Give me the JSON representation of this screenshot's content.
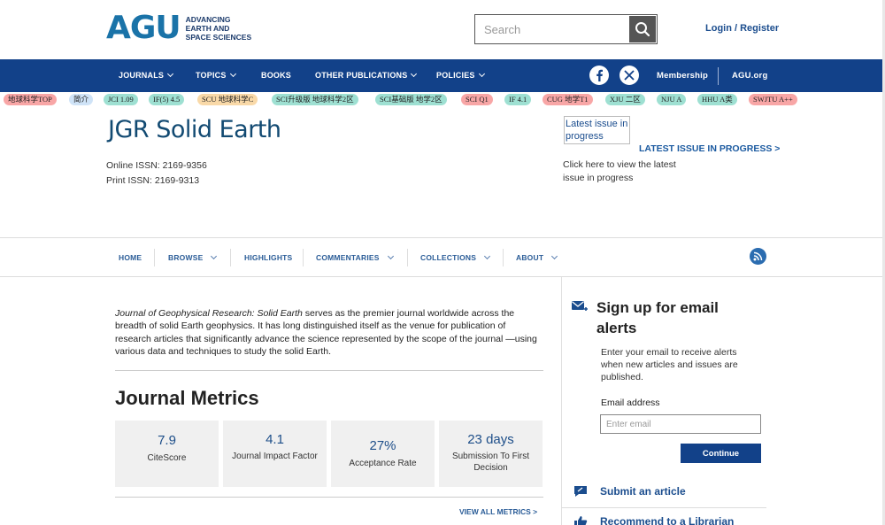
{
  "header": {
    "logo_mark": "AGU",
    "logo_line1": "ADVANCING",
    "logo_line2": "EARTH AND",
    "logo_line3": "SPACE SCIENCES",
    "search_placeholder": "Search",
    "login_label": "Login / Register"
  },
  "navbar": {
    "items": [
      {
        "label": "JOURNALS"
      },
      {
        "label": "TOPICS"
      },
      {
        "label": "BOOKS"
      },
      {
        "label": "OTHER PUBLICATIONS"
      },
      {
        "label": "POLICIES"
      }
    ],
    "membership": "Membership",
    "agu_org": "AGU.org"
  },
  "tags": [
    {
      "label": "地球科学TOP",
      "color": "#f8a6a6"
    },
    {
      "label": "简介",
      "color": "#cfe3f7"
    },
    {
      "label": "JCI 1.09",
      "color": "#9ee0d2"
    },
    {
      "label": "IF(5) 4.5",
      "color": "#9ee0d2"
    },
    {
      "label": "SCU 地球科学C",
      "color": "#f9d9a8"
    },
    {
      "label": "SCI升级版 地球科学2区",
      "color": "#9ee0d2"
    },
    {
      "label": "SCI基础版 地学2区",
      "color": "#9ee0d2"
    },
    {
      "label": "SCI Q1",
      "color": "#f8a6a6"
    },
    {
      "label": "IF 4.1",
      "color": "#9ee0d2"
    },
    {
      "label": "CUG 地学T1",
      "color": "#f8a6a6"
    },
    {
      "label": "XJU 二区",
      "color": "#9ee0d2"
    },
    {
      "label": "NJU A",
      "color": "#9ee0d2"
    },
    {
      "label": "HHU A类",
      "color": "#9ee0d2"
    },
    {
      "label": "SWJTU A++",
      "color": "#f8a6a6"
    }
  ],
  "journal": {
    "title": "JGR Solid Earth",
    "online_issn": "Online ISSN: 2169-9356",
    "print_issn": "Print ISSN: 2169-9313",
    "latest_img_alt": "Latest issue in progress",
    "latest_link": "LATEST ISSUE IN PROGRESS >",
    "latest_desc": "Click here to view the latest issue in progress"
  },
  "subnav": {
    "items": [
      {
        "label": "HOME"
      },
      {
        "label": "BROWSE"
      },
      {
        "label": "HIGHLIGHTS"
      },
      {
        "label": "COMMENTARIES"
      },
      {
        "label": "COLLECTIONS"
      },
      {
        "label": "ABOUT"
      }
    ]
  },
  "main": {
    "intro_journal": "Journal of Geophysical Research: Solid Earth",
    "intro_rest": " serves as the premier journal worldwide across the breadth of solid Earth geophysics. It has long distinguished itself as the venue for publication of research articles that significantly advance the science represented by the scope of the journal —using various data and techniques to study the solid Earth.",
    "metrics_title": "Journal Metrics",
    "metrics": [
      {
        "value": "7.9",
        "label": "CiteScore"
      },
      {
        "value": "4.1",
        "label": "Journal Impact Factor"
      },
      {
        "value": "27%",
        "label": "Acceptance Rate"
      },
      {
        "value": "23 days",
        "label": "Submission To First Decision"
      }
    ],
    "view_all": "VIEW ALL METRICS >"
  },
  "sidebar": {
    "signup_title": "Sign up for email alerts",
    "signup_desc": "Enter your email to receive alerts when new articles and issues are published.",
    "email_label": "Email address",
    "email_placeholder": "Enter email",
    "continue_label": "Continue",
    "submit_label": "Submit an article",
    "recommend_label": "Recommend to a Librarian"
  }
}
